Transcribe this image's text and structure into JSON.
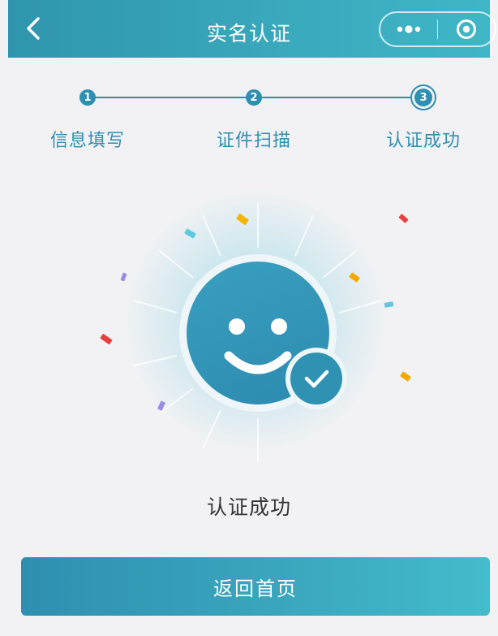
{
  "navbar": {
    "title": "实名认证",
    "back_icon": "chevron-left-icon",
    "more_icon": "more-dots-icon",
    "close_icon": "target-circle-icon"
  },
  "steps": [
    {
      "number": "1",
      "label": "信息填写"
    },
    {
      "number": "2",
      "label": "证件扫描"
    },
    {
      "number": "3",
      "label": "认证成功"
    }
  ],
  "result": {
    "icon": "smiley-face-icon",
    "badge_icon": "checkmark-icon",
    "message": "认证成功"
  },
  "actions": {
    "home_button": "返回首页"
  },
  "colors": {
    "accent": "#2f8fb0",
    "navbar_end": "#3fb6c6",
    "background": "#f2f2f4",
    "text": "#333333"
  }
}
